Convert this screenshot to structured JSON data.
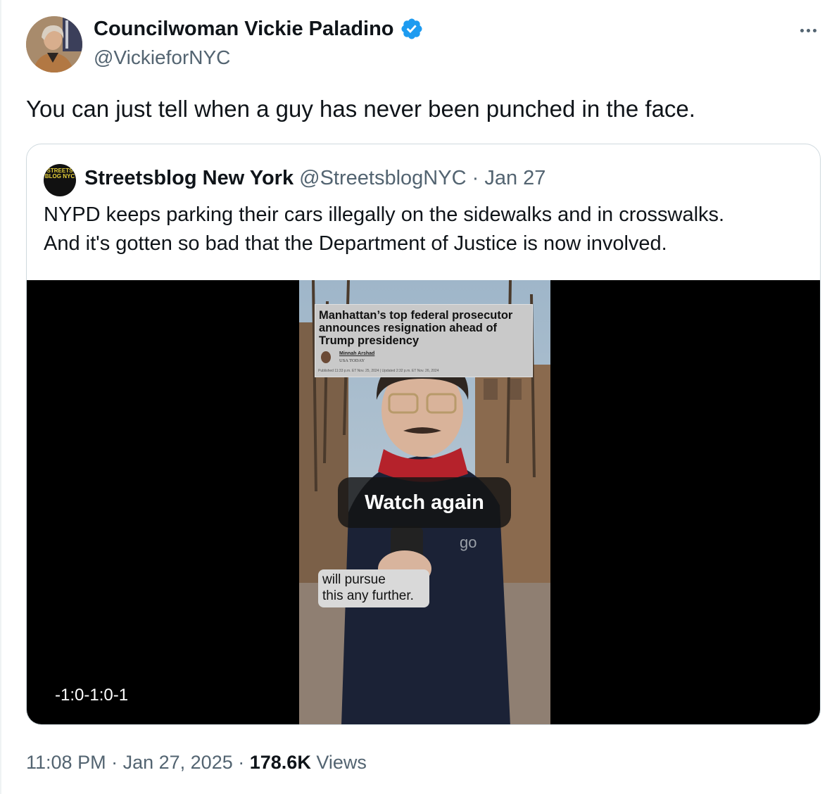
{
  "tweet": {
    "author_name": "Councilwoman Vickie Paladino",
    "author_handle": "@VickieforNYC",
    "text": "You can just tell when a guy has never been punched in the face.",
    "time": "11:08 PM",
    "date": "Jan 27, 2025",
    "views_count": "178.6K",
    "views_label": "Views"
  },
  "quoted_tweet": {
    "avatar_text": "STREETS BLOG NYC",
    "author_name": "Streetsblog New York",
    "author_handle": "@StreetsblogNYC",
    "date": "Jan 27",
    "text_lines": [
      "NYPD keeps parking their cars illegally on the sidewalks and in crosswalks.",
      "And it's gotten so bad that the Department of Justice is now involved."
    ]
  },
  "video": {
    "headline": "Manhattan’s top federal prosecutor announces resignation ahead of Trump presidency",
    "byline_author": "Minnah Arshad",
    "byline_outlet": "USA TODAY",
    "byline_dates": "Published 11:33 p.m. ET Nov. 25, 2024 | Updated 2:32 p.m. ET Nov. 26, 2024",
    "watch_again_label": "Watch again",
    "caption_lines": [
      "will pursue",
      "this any further."
    ],
    "timecode": "-1:0-1:0-1"
  },
  "colors": {
    "verified_blue": "#1d9bf0",
    "muted_text": "#536471",
    "border": "#cfd9de"
  }
}
